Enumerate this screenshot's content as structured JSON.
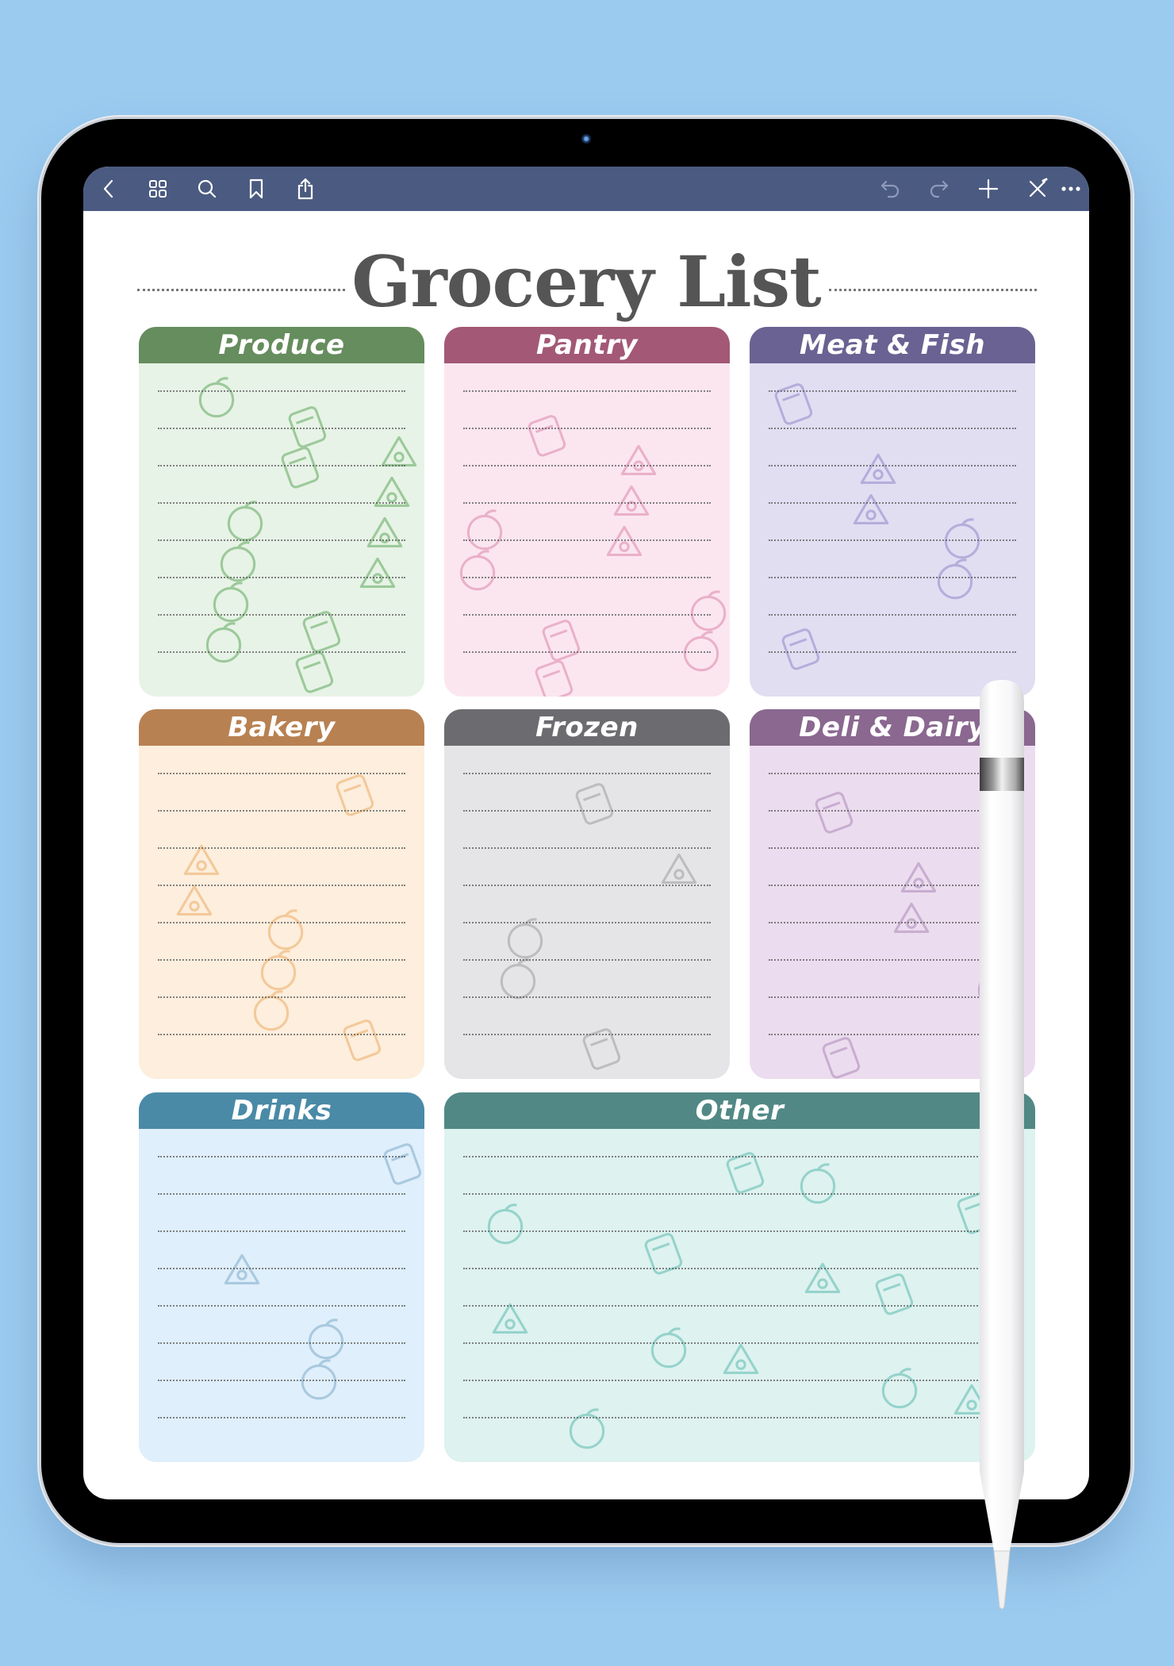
{
  "toolbar": {
    "left_icons": [
      {
        "name": "back-icon",
        "label": "Back"
      },
      {
        "name": "grid-icon",
        "label": "Thumbnails"
      },
      {
        "name": "search-icon",
        "label": "Search"
      },
      {
        "name": "bookmark-icon",
        "label": "Bookmark"
      },
      {
        "name": "share-icon",
        "label": "Share"
      }
    ],
    "right_icons": [
      {
        "name": "undo-icon",
        "label": "Undo"
      },
      {
        "name": "redo-icon",
        "label": "Redo"
      },
      {
        "name": "add-icon",
        "label": "Add page"
      },
      {
        "name": "pen-off-icon",
        "label": "Toggle pen"
      },
      {
        "name": "more-icon",
        "label": "More"
      }
    ],
    "color": "#4b5a80"
  },
  "page": {
    "title": "Grocery List",
    "title_color": "#555555"
  },
  "sections": [
    {
      "label": "Produce",
      "header_color": "#668d5e",
      "body_color": "#e7f3e6",
      "icon_color": "#9cc99a",
      "lines": 8,
      "icons": [
        "onion",
        "pear",
        "broccoli",
        "grapes",
        "leaf",
        "beet",
        "watermelon",
        "orange",
        "carrot",
        "eggplant",
        "pepper",
        "peas",
        "apple"
      ]
    },
    {
      "label": "Pantry",
      "header_color": "#a35876",
      "body_color": "#fbe6f0",
      "icon_color": "#eab1c8",
      "lines": 8,
      "icons": [
        "pasta-box",
        "oil-bottle",
        "flour-bag",
        "nut",
        "wheat",
        "biscuit",
        "can",
        "tea",
        "coffee-bean",
        "salt"
      ]
    },
    {
      "label": "Meat & Fish",
      "header_color": "#6a6292",
      "body_color": "#e1def2",
      "icon_color": "#b5aedb",
      "lines": 8,
      "icons": [
        "sausage",
        "fish",
        "bacon",
        "steak",
        "chicken-leg",
        "fish-head"
      ]
    },
    {
      "label": "Bakery",
      "header_color": "#b88152",
      "body_color": "#fdeedd",
      "icon_color": "#f3c99a",
      "lines": 8,
      "icons": [
        "bread",
        "baguette",
        "croissant",
        "pretzel",
        "cookie",
        "toast",
        "donut"
      ]
    },
    {
      "label": "Frozen",
      "header_color": "#6c6c70",
      "body_color": "#e5e5e7",
      "icon_color": "#bdbdc0",
      "lines": 8,
      "icons": [
        "frozen-bag",
        "snowflake",
        "ice-cream",
        "popsicle",
        "frozen-veg"
      ]
    },
    {
      "label": "Deli & Dairy",
      "header_color": "#8a6890",
      "body_color": "#ecdcef",
      "icon_color": "#c8aed0",
      "lines": 8,
      "icons": [
        "cake",
        "muffin",
        "macaron",
        "milk-carton",
        "donut",
        "cheese"
      ]
    },
    {
      "label": "Drinks",
      "header_color": "#4a8aa7",
      "body_color": "#dfeffb",
      "icon_color": "#a9c9df",
      "lines": 8,
      "icons": [
        "bottle",
        "wine-bottle",
        "can",
        "juice-carton"
      ]
    },
    {
      "label": "Other",
      "header_color": "#518885",
      "body_color": "#def2f0",
      "icon_color": "#95d3cb",
      "lines": 8,
      "icons": [
        "toilet-paper",
        "rubber-duck",
        "light-bulb",
        "lollipop",
        "kite",
        "burger",
        "toothpaste",
        "candy",
        "pizza",
        "fries",
        "toothbrush",
        "noodle-box",
        "coffee-cup"
      ]
    }
  ],
  "device": {
    "background_color": "#9ccbf0",
    "accessory": "stylus-pencil"
  }
}
